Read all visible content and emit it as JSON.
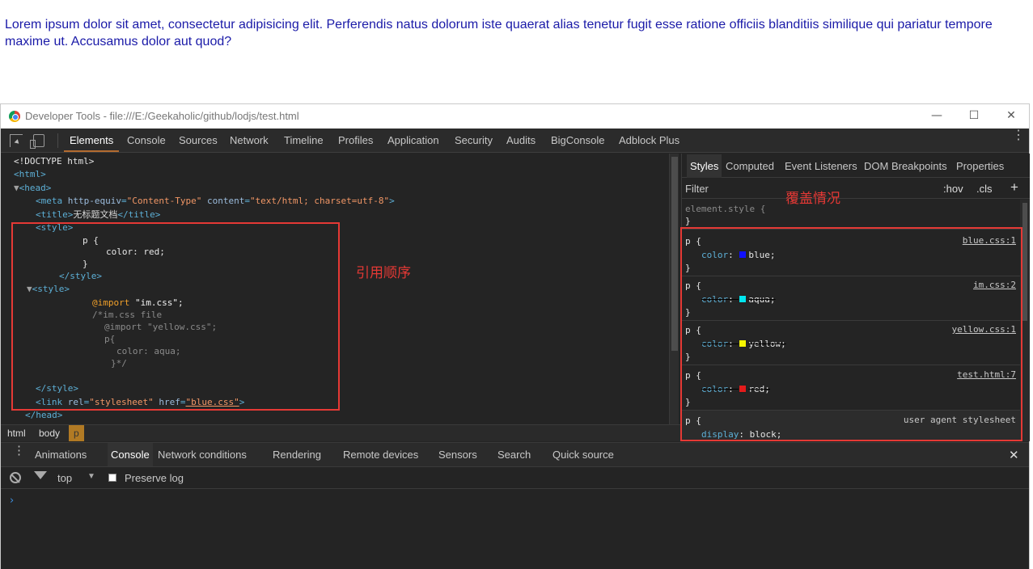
{
  "page": {
    "paragraph": "Lorem ipsum dolor sit amet, consectetur adipisicing elit. Perferendis natus dolorum iste quaerat alias tenetur fugit esse ratione officiis blanditiis similique qui pariatur tempore maxime ut. Accusamus dolor aut quod?"
  },
  "window": {
    "title": "Developer Tools - file:///E:/Geekaholic/github/lodjs/test.html",
    "min": "—",
    "max": "☐",
    "close": "✕"
  },
  "toolbar": {
    "tabs": [
      "Elements",
      "Console",
      "Sources",
      "Network",
      "Timeline",
      "Profiles",
      "Application",
      "Security",
      "Audits",
      "BigConsole",
      "Adblock Plus"
    ],
    "more": "⋮"
  },
  "elements": {
    "doctype": "<!DOCTYPE html>",
    "html_open": "<html>",
    "head_open": "<head>",
    "meta_tag": "meta",
    "meta_attr1": "http-equiv",
    "meta_val1": "\"Content-Type\"",
    "meta_attr2": "content",
    "meta_val2": "\"text/html; charset=utf-8\"",
    "title_open": "<title>",
    "title_text": "无标题文档",
    "title_close": "</title>",
    "style_open": "<style>",
    "css_sel": "p {",
    "css_decl": "color: red;",
    "css_close": "}",
    "style_close": "</style>",
    "style2_open": "<style>",
    "import_kw": "@import",
    "import_val": "\"im.css\";",
    "comment1": "/*im.css file",
    "comment2": "@import \"yellow.css\";",
    "comment3": "p{",
    "comment4": "color: aqua;",
    "comment5": "}*/",
    "style2_close": "</style>",
    "link_tag": "link",
    "link_attr1": "rel",
    "link_val1": "\"stylesheet\"",
    "link_attr2": "href",
    "link_val2": "\"blue.css\"",
    "head_close": "</head>"
  },
  "breadcrumb": [
    "html",
    "body",
    "p"
  ],
  "styles": {
    "tabs": [
      "Styles",
      "Computed",
      "Event Listeners",
      "DOM Breakpoints",
      "Properties"
    ],
    "filter": "Filter",
    "hov": ":hov",
    "cls": ".cls",
    "add": "+",
    "element_style": "element.style {",
    "close_brace": "}",
    "rules": [
      {
        "selector": "p {",
        "prop": "color",
        "value": "blue;",
        "source": "blue.css:1",
        "swatch": "#1010ff",
        "overridden": false
      },
      {
        "selector": "p {",
        "prop": "color",
        "value": "aqua;",
        "source": "im.css:2",
        "swatch": "#00e5ee",
        "overridden": true
      },
      {
        "selector": "p {",
        "prop": "color",
        "value": "yellow;",
        "source": "yellow.css:1",
        "swatch": "#f5f500",
        "overridden": true
      },
      {
        "selector": "p {",
        "prop": "color",
        "value": "red;",
        "source": "test.html:7",
        "swatch": "#e41b1b",
        "overridden": true
      }
    ],
    "ua_selector": "p {",
    "ua_source": "user agent stylesheet",
    "ua_prop": "display",
    "ua_value": "block;"
  },
  "drawer": {
    "tabs": [
      "Animations",
      "Console",
      "Network conditions",
      "Rendering",
      "Remote devices",
      "Sensors",
      "Search",
      "Quick source"
    ],
    "close": "✕"
  },
  "console": {
    "context": "top",
    "preserve_log": "Preserve log",
    "prompt": "›"
  },
  "annotations": {
    "order": "引用顺序",
    "override": "覆盖情况"
  },
  "colors": {
    "accent_red": "#e53935",
    "page_text": "#1a1aa8",
    "devtools_bg": "#242424"
  }
}
